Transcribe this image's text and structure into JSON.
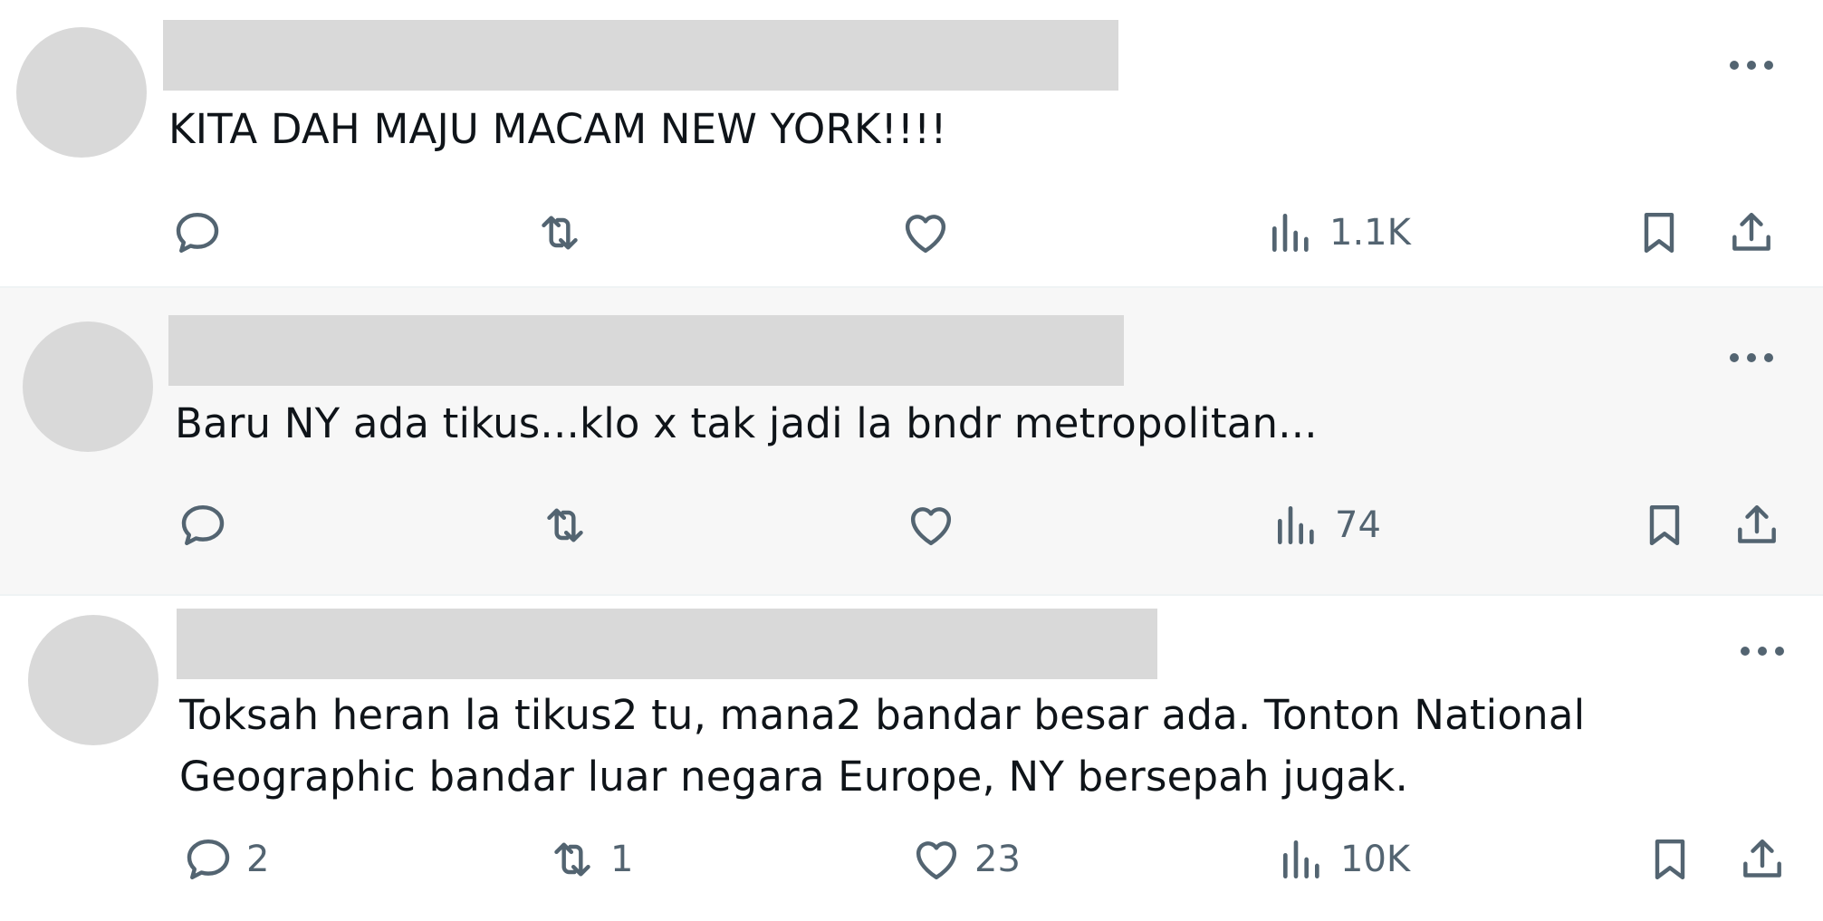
{
  "tweets": [
    {
      "text_lines": [
        "KITA DAH MAJU MACAM NEW YORK!!!!"
      ],
      "highlighted": false,
      "actions": {
        "reply": "",
        "retweet": "",
        "like": "",
        "views": "1.1K"
      }
    },
    {
      "text_lines": [
        "Baru NY ada tikus...klo x tak jadi la bndr metropolitan..."
      ],
      "highlighted": true,
      "actions": {
        "reply": "",
        "retweet": "",
        "like": "",
        "views": "74"
      }
    },
    {
      "text_lines": [
        "Toksah heran la tikus2 tu, mana2 bandar besar ada. Tonton National",
        "Geographic bandar luar negara Europe, NY bersepah jugak."
      ],
      "highlighted": false,
      "actions": {
        "reply": "2",
        "retweet": "1",
        "like": "23",
        "views": "10K"
      }
    }
  ],
  "icons": [
    "avatar-placeholder",
    "more-icon",
    "reply-icon",
    "retweet-icon",
    "like-icon",
    "views-icon",
    "bookmark-icon",
    "share-icon"
  ],
  "colors": {
    "background": "#ffffff",
    "highlight": "#f7f7f7",
    "placeholder": "#d9d9d9",
    "icon": "#536471",
    "text": "#0f1419"
  }
}
